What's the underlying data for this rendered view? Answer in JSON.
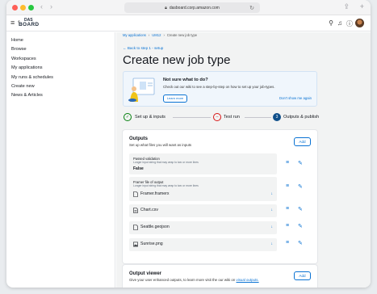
{
  "browser": {
    "url": "dasboard.corp.amazon.com"
  },
  "app": {
    "logo_line1": "DAS",
    "logo_line2": "BOARD"
  },
  "sidebar": {
    "items": [
      {
        "label": "Home"
      },
      {
        "label": "Browse"
      },
      {
        "label": "Workspaces"
      },
      {
        "label": "My applications"
      },
      {
        "label": "My runs & schedules"
      },
      {
        "label": "Create new"
      },
      {
        "label": "News & Articles"
      }
    ]
  },
  "breadcrumb": {
    "items": [
      "My applications",
      "UM12",
      "Create new job type"
    ]
  },
  "back_link": "← Back to step 1 - setup",
  "page_title": "Create new job type",
  "help": {
    "title": "Not sure what to do?",
    "text": "Check out our wiki to see a step-by-step on how to set up your job-types.",
    "learn_more": "Learn more",
    "dismiss": "Don't show me again"
  },
  "steps": [
    {
      "label": "Set up & inputs",
      "marker": "✓",
      "state": "done"
    },
    {
      "label": "Test run",
      "marker": "–",
      "state": "error"
    },
    {
      "label": "Outputs & publish",
      "marker": "3",
      "state": "current"
    }
  ],
  "outputs": {
    "title": "Outputs",
    "subtitle": "Set up what files you will want as inputs",
    "add_label": "Add",
    "rows": [
      {
        "label": "Passed validation",
        "desc": "Longer input string that may wrap to two or more lines",
        "value": "False"
      },
      {
        "label": "Framer file of output",
        "desc": "Longer input string that may wrap to two or more lines",
        "file": "Framer.framerx",
        "icon": "file-icon"
      }
    ],
    "files": [
      {
        "name": "Chart.csv",
        "icon": "csv-file-icon"
      },
      {
        "name": "Seattle.geojson",
        "icon": "file-icon"
      },
      {
        "name": "Sunrise.png",
        "icon": "image-file-icon"
      }
    ]
  },
  "viewer": {
    "title": "Output viewer",
    "text": "Give your user enhanced outputs, to learn more visit the our wiki on",
    "link": "visual outputs.",
    "add_label": "Add"
  },
  "colors": {
    "accent": "#0972d3",
    "success": "#037f0c",
    "error": "#d91515",
    "current": "#0f4f8a"
  }
}
